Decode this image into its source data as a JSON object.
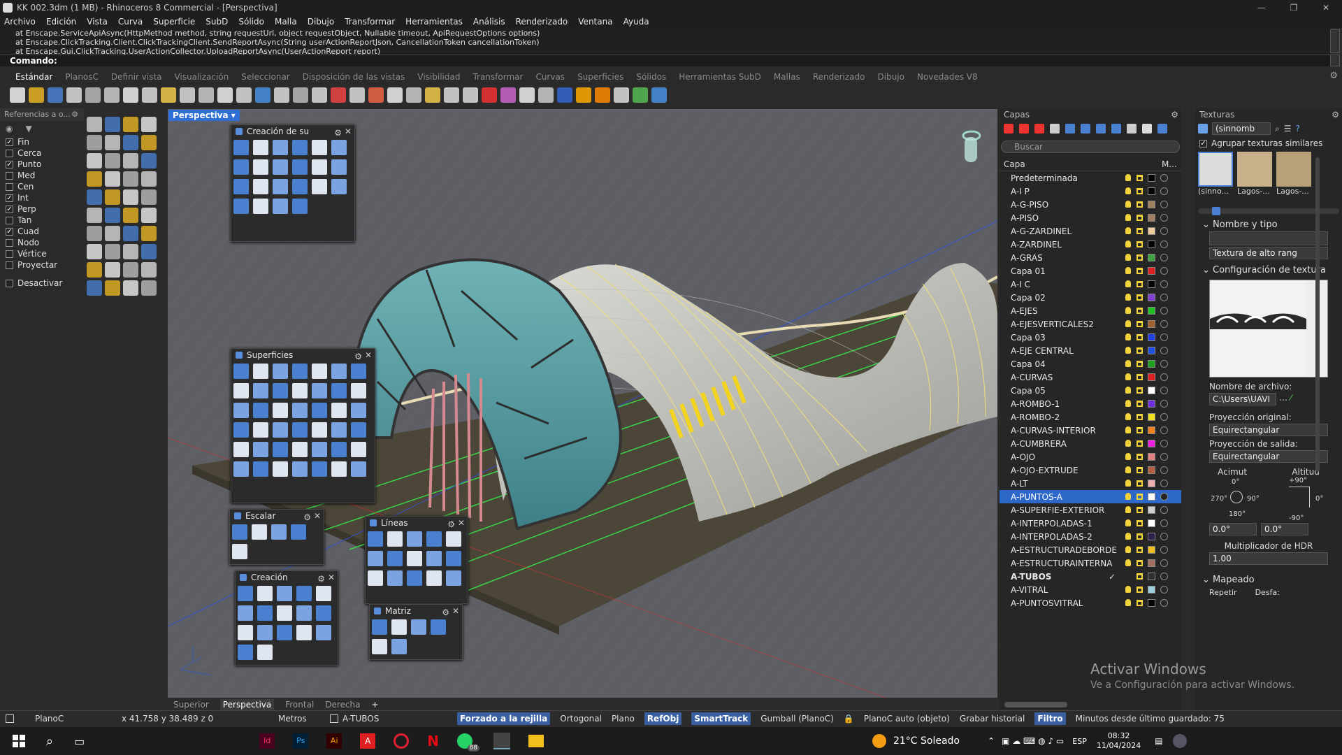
{
  "window": {
    "title": "KK 002.3dm (1 MB) - Rhinoceros 8 Commercial - [Perspectiva]"
  },
  "menu": [
    "Archivo",
    "Edición",
    "Vista",
    "Curva",
    "Superficie",
    "SubD",
    "Sólido",
    "Malla",
    "Dibujo",
    "Transformar",
    "Herramientas",
    "Análisis",
    "Renderizado",
    "Ventana",
    "Ayuda"
  ],
  "cmd": {
    "history": [
      "at Enscape.ServiceApiAsync(HttpMethod method, string requestUrl, object requestObject, Nullable timeout, ApiRequestOptions options)",
      "at Enscape.ClickTracking.Client.ClickTrackingClient.SendReportAsync(String userActionReportJson, CancellationToken cancellationToken)",
      "at Enscape.Gui.ClickTracking.UserActionCollector.UploadReportAsync(UserActionReport report)"
    ],
    "prompt": "Comando:"
  },
  "toolbar_tabs": [
    "Estándar",
    "PlanosC",
    "Definir vista",
    "Visualización",
    "Seleccionar",
    "Disposición de las vistas",
    "Visibilidad",
    "Transformar",
    "Curvas",
    "Superficies",
    "Sólidos",
    "Herramientas SubD",
    "Mallas",
    "Renderizado",
    "Dibujo",
    "Novedades V8"
  ],
  "osnap": {
    "header": "Referencias a o...",
    "items": [
      {
        "label": "Fin",
        "checked": true
      },
      {
        "label": "Cerca",
        "checked": false
      },
      {
        "label": "Punto",
        "checked": true
      },
      {
        "label": "Med",
        "checked": false
      },
      {
        "label": "Cen",
        "checked": false
      },
      {
        "label": "Int",
        "checked": true
      },
      {
        "label": "Perp",
        "checked": true
      },
      {
        "label": "Tan",
        "checked": false
      },
      {
        "label": "Cuad",
        "checked": true
      },
      {
        "label": "Nodo",
        "checked": false
      },
      {
        "label": "Vértice",
        "checked": false
      },
      {
        "label": "Proyectar",
        "checked": false
      }
    ],
    "disable": "Desactivar"
  },
  "viewport": {
    "title": "Perspectiva",
    "tabs": [
      "Superior",
      "Perspectiva",
      "Frontal",
      "Derecha"
    ],
    "add": "+"
  },
  "floats": {
    "creacion_sup": "Creación de su",
    "superficies": "Superficies",
    "escalar": "Escalar",
    "creacion": "Creación",
    "lineas": "Líneas",
    "matriz": "Matriz"
  },
  "layers": {
    "panel_title": "Capas",
    "search_placeholder": "Buscar",
    "col_layer": "Capa",
    "col_m": "M...",
    "items": [
      {
        "name": "Predeterminada",
        "color": "#000000"
      },
      {
        "name": "A-I P",
        "color": "#000000"
      },
      {
        "name": "A-G-PISO",
        "color": "#a08060"
      },
      {
        "name": "A-PISO",
        "color": "#a08060"
      },
      {
        "name": "A-G-ZARDINEL",
        "color": "#f0d0a0"
      },
      {
        "name": "A-ZARDINEL",
        "color": "#000000"
      },
      {
        "name": "A-GRAS",
        "color": "#40a040"
      },
      {
        "name": "Capa 01",
        "color": "#e02020"
      },
      {
        "name": "A-I C",
        "color": "#000000"
      },
      {
        "name": "Capa 02",
        "color": "#8040d0"
      },
      {
        "name": "A-EJES",
        "color": "#20c020"
      },
      {
        "name": "A-EJESVERTICALES2",
        "color": "#a06030"
      },
      {
        "name": "Capa 03",
        "color": "#2040e0"
      },
      {
        "name": "A-EJE CENTRAL",
        "color": "#2050e0"
      },
      {
        "name": "Capa 04",
        "color": "#20a020"
      },
      {
        "name": "A-CURVAS",
        "color": "#e02020"
      },
      {
        "name": "Capa 05",
        "color": "#ffffff"
      },
      {
        "name": "A-ROMBO-1",
        "color": "#7030e0"
      },
      {
        "name": "A-ROMBO-2",
        "color": "#f0e020"
      },
      {
        "name": "A-CURVAS-INTERIOR",
        "color": "#f08020"
      },
      {
        "name": "A-CUMBRERA",
        "color": "#f020e0"
      },
      {
        "name": "A-OJO",
        "color": "#e08080"
      },
      {
        "name": "A-OJO-EXTRUDE",
        "color": "#b06040"
      },
      {
        "name": "A-LT",
        "color": "#f0b0b0"
      },
      {
        "name": "A-PUNTOS-A",
        "color": "#ffffff"
      },
      {
        "name": "A-SUPERFIE-EXTERIOR",
        "color": "#d0d0d0"
      },
      {
        "name": "A-INTERPOLADAS-1",
        "color": "#ffffff"
      },
      {
        "name": "A-INTERPOLADAS-2",
        "color": "#302050"
      },
      {
        "name": "A-ESTRUCTURADEBORDE",
        "color": "#f0c020"
      },
      {
        "name": "A-ESTRUCTURAINTERNA",
        "color": "#a07060"
      },
      {
        "name": "A-TUBOS",
        "color": "#303030"
      },
      {
        "name": "A-VITRAL",
        "color": "#a0d0e0"
      },
      {
        "name": "A-PUNTOSVITRAL",
        "color": "#000000"
      }
    ],
    "selected_index": 24,
    "current_index": 30
  },
  "textures": {
    "panel_title": "Texturas",
    "dropdown": "(sinnomb",
    "group_similar": "Agrupar texturas similares",
    "thumbs": [
      "(sinno...",
      "Lagos-...",
      "Lagos-..."
    ],
    "sec_name": "Nombre y tipo",
    "type": "Textura de alto rang",
    "sec_config": "Configuración de textura",
    "file_label": "Nombre de archivo:",
    "file_value": "C:\\Users\\UAVI",
    "proj_orig_label": "Proyección original:",
    "proj_orig": "Equirectangular",
    "proj_out_label": "Proyección de salida:",
    "proj_out": "Equirectangular",
    "azimut": "Acimut",
    "altitud": "Altitud",
    "az_top": "0°",
    "az_left": "270°",
    "az_right": "90°",
    "az_bottom": "180°",
    "alt_top": "+90°",
    "alt_right": "0°",
    "alt_bottom": "-90°",
    "az_value": "0.0°",
    "alt_value": "0.0°",
    "hdr_label": "Multiplicador de HDR",
    "hdr_value": "1.00",
    "sec_map": "Mapeado",
    "repeat": "Repetir",
    "offset": "Desfa:"
  },
  "watermark": {
    "line1": "Activar Windows",
    "line2": "Ve a Configuración para activar Windows."
  },
  "status": {
    "cplane": "PlanoC",
    "coords": "x 41.758 y 38.489 z 0",
    "units": "Metros",
    "layer": "A-TUBOS",
    "grid_snap": "Forzado a la rejilla",
    "ortho": "Ortogonal",
    "planar": "Plano",
    "osnap": "RefObj",
    "smarttrack": "SmartTrack",
    "gumball": "Gumball (PlanoC)",
    "autocplane": "PlanoC auto (objeto)",
    "history": "Grabar historial",
    "filter": "Filtro",
    "saved": "Minutos desde último guardado: 75"
  },
  "taskbar": {
    "weather": "21°C Soleado",
    "lang": "ESP",
    "time": "08:32",
    "date": "11/04/2024",
    "badge": "88"
  }
}
